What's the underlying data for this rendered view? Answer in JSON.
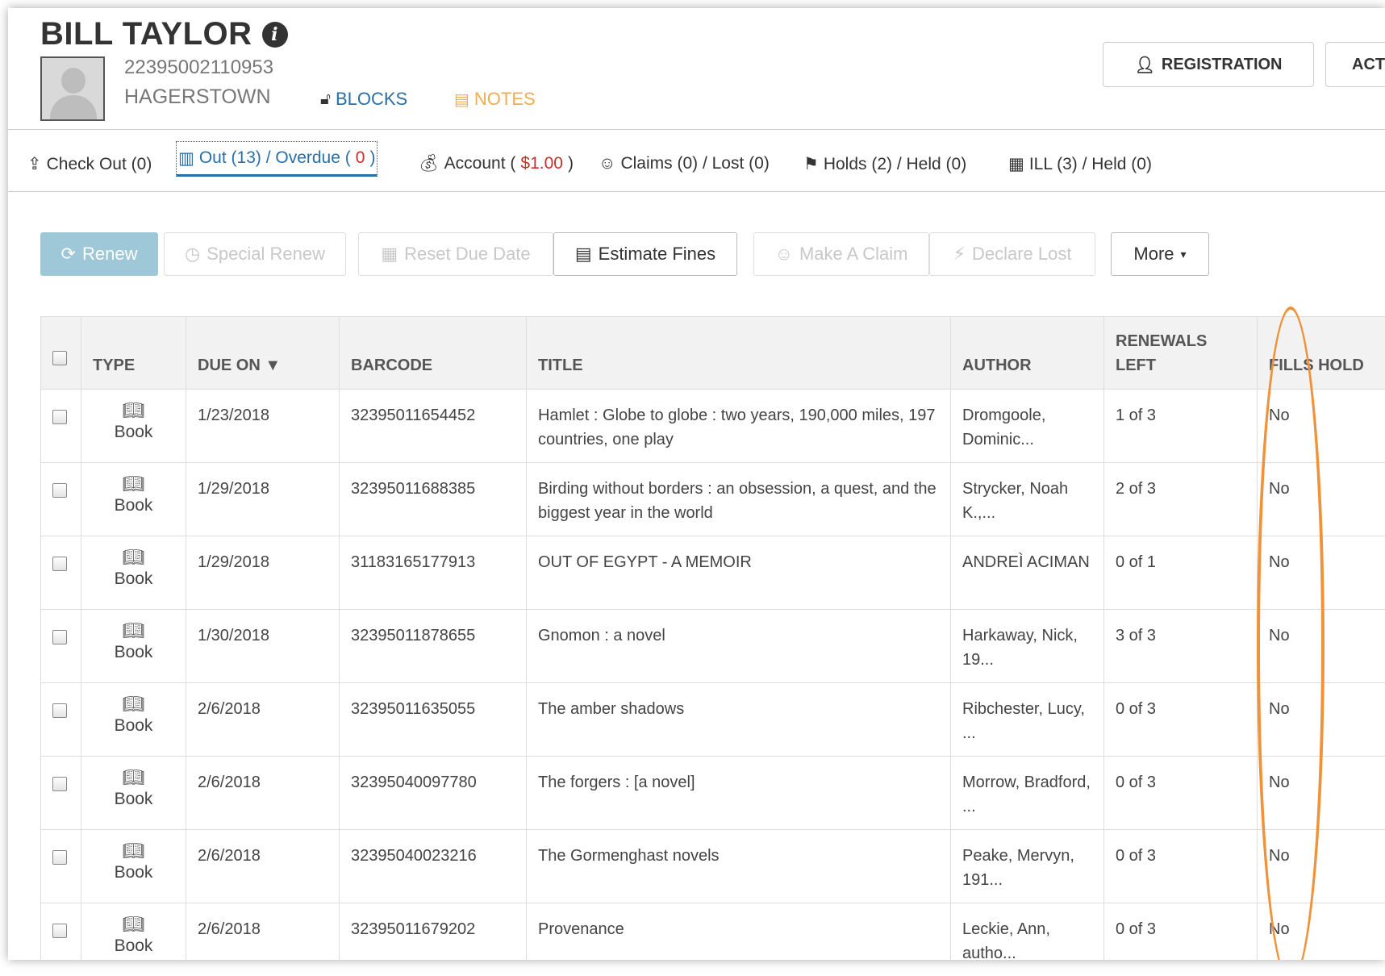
{
  "patron": {
    "name": "BILL TAYLOR",
    "barcode": "22395002110953",
    "branch": "HAGERSTOWN",
    "blocks_label": "BLOCKS",
    "notes_label": "NOTES"
  },
  "header_buttons": {
    "registration": "REGISTRATION",
    "actions": "ACT"
  },
  "tabs": [
    {
      "label": "Check Out (0)",
      "icon": "upload-icon"
    },
    {
      "label_a": "Out (13) / Overdue (",
      "label_b": "0",
      "label_c": ")",
      "icon": "books-icon"
    },
    {
      "label_a": "Account (",
      "label_b": "$1.00",
      "label_c": ")",
      "icon": "money-icon"
    },
    {
      "label": "Claims (0) / Lost (0)",
      "icon": "smile-icon"
    },
    {
      "label": "Holds (2) / Held (0)",
      "icon": "flag-icon"
    },
    {
      "label": "ILL (3) / Held (0)",
      "icon": "building-icon"
    }
  ],
  "toolbar": {
    "renew": "Renew",
    "special_renew": "Special Renew",
    "reset_due_date": "Reset Due Date",
    "estimate_fines": "Estimate Fines",
    "make_claim": "Make A Claim",
    "declare_lost": "Declare Lost",
    "more": "More"
  },
  "table": {
    "headers": {
      "type": "TYPE",
      "due_on": "DUE ON ▼",
      "barcode": "BARCODE",
      "title": "TITLE",
      "author": "AUTHOR",
      "renewals_left": "RENEWALS LEFT",
      "fills_hold": "FILLS HOLD"
    },
    "rows": [
      {
        "type": "Book",
        "due": "1/23/2018",
        "barcode": "32395011654452",
        "title": "Hamlet : Globe to globe : two years, 190,000 miles, 197 countries, one play",
        "author": "Dromgoole, Dominic...",
        "renewals": "1 of 3",
        "fills_hold": "No"
      },
      {
        "type": "Book",
        "due": "1/29/2018",
        "barcode": "32395011688385",
        "title": "Birding without borders : an obsession, a quest, and the biggest year in the world",
        "author": "Strycker, Noah K.,...",
        "renewals": "2 of 3",
        "fills_hold": "No"
      },
      {
        "type": "Book",
        "due": "1/29/2018",
        "barcode": "31183165177913",
        "title": "OUT OF EGYPT - A MEMOIR",
        "author": "ANDREÌ ACIMAN",
        "renewals": "0 of 1",
        "fills_hold": "No"
      },
      {
        "type": "Book",
        "due": "1/30/2018",
        "barcode": "32395011878655",
        "title": "Gnomon : a novel",
        "author": "Harkaway, Nick, 19...",
        "renewals": "3 of 3",
        "fills_hold": "No"
      },
      {
        "type": "Book",
        "due": "2/6/2018",
        "barcode": "32395011635055",
        "title": "The amber shadows",
        "author": "Ribchester, Lucy, ...",
        "renewals": "0 of 3",
        "fills_hold": "No"
      },
      {
        "type": "Book",
        "due": "2/6/2018",
        "barcode": "32395040097780",
        "title": "The forgers : [a novel]",
        "author": "Morrow, Bradford, ...",
        "renewals": "0 of 3",
        "fills_hold": "No"
      },
      {
        "type": "Book",
        "due": "2/6/2018",
        "barcode": "32395040023216",
        "title": "The Gormenghast novels",
        "author": "Peake, Mervyn, 191...",
        "renewals": "0 of 3",
        "fills_hold": "No"
      },
      {
        "type": "Book",
        "due": "2/6/2018",
        "barcode": "32395011679202",
        "title": "Provenance",
        "author": "Leckie, Ann, autho...",
        "renewals": "0 of 3",
        "fills_hold": "No"
      }
    ]
  },
  "colors": {
    "link_blue": "#2a6ea6",
    "overdue_red": "#c9302c",
    "notes_orange": "#f0ad4e",
    "renew_button": "#9ec8d8",
    "annotation_orange": "#f0923a"
  }
}
